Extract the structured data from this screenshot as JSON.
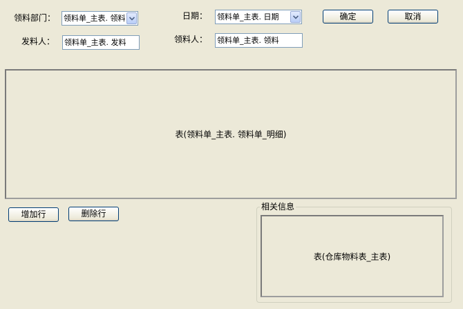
{
  "form": {
    "dept_label": "领料部门：",
    "dept_value": "领料单_主表. 领料",
    "date_label": "日期：",
    "date_value": "领料单_主表. 日期",
    "sender_label": "发料人：",
    "sender_value": "领料单_主表. 发料",
    "receiver_label": "领料人：",
    "receiver_value": "领料单_主表. 领料"
  },
  "toolbar": {
    "ok_label": "确定",
    "cancel_label": "取消"
  },
  "detail_table": {
    "placeholder": "表(领料单_主表. 领料单_明细)"
  },
  "row_actions": {
    "add_label": "增加行",
    "delete_label": "删除行"
  },
  "related_info": {
    "title": "相关信息",
    "table_placeholder": "表(仓库物料表_主表)"
  },
  "icons": {
    "combo_arrow": "chevron-down-icon"
  }
}
